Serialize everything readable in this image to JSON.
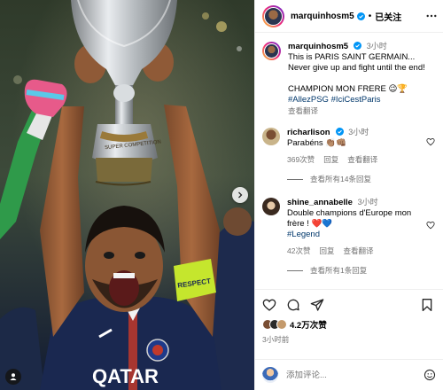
{
  "post": {
    "username": "marquinhosm5",
    "follow_label": "已关注",
    "dot": "•",
    "caption": {
      "time": "3小时",
      "lines": [
        "This is PARIS SAINT GERMAIN...",
        "Never give up and fight until the end!"
      ],
      "line_3": "CHAMPION MON FRERE 😉🏆",
      "hashtags": [
        "#AllezPSG",
        "#IciCestParis"
      ],
      "see_translation": "查看翻译"
    },
    "comments": [
      {
        "username": "richarlison",
        "time": "3小时",
        "text": "Parabéns 👏🏽👊🏽",
        "likes": "369次赞",
        "reply": "回复",
        "translate": "查看翻译",
        "view_replies": "查看所有14条回复"
      },
      {
        "username": "shine_annabelle",
        "time": "3小时",
        "text": "Double champions d'Europe mon frère ! ❤️💙",
        "hashtag": "#Legend",
        "likes": "42次赞",
        "reply": "回复",
        "translate": "查看翻译",
        "view_replies": "查看所有1条回复"
      }
    ],
    "likes_count": "4.2万次赞",
    "posted_ago": "3小时前",
    "comment_placeholder": "添加评论..."
  },
  "photo": {
    "trophy_text": "SUPER COMPETITION",
    "armband_text": "RESPECT",
    "jersey_text": "QATAR"
  },
  "colors": {
    "link": "#00376b",
    "secondary_text": "#737373",
    "verified": "#0095f6",
    "heart_red": "#ed4956"
  },
  "icons": [
    "more-icon",
    "verified-icon",
    "heart-icon",
    "comment-icon",
    "share-icon",
    "save-icon",
    "emoji-icon",
    "next-arrow-icon",
    "user-tag-icon"
  ]
}
